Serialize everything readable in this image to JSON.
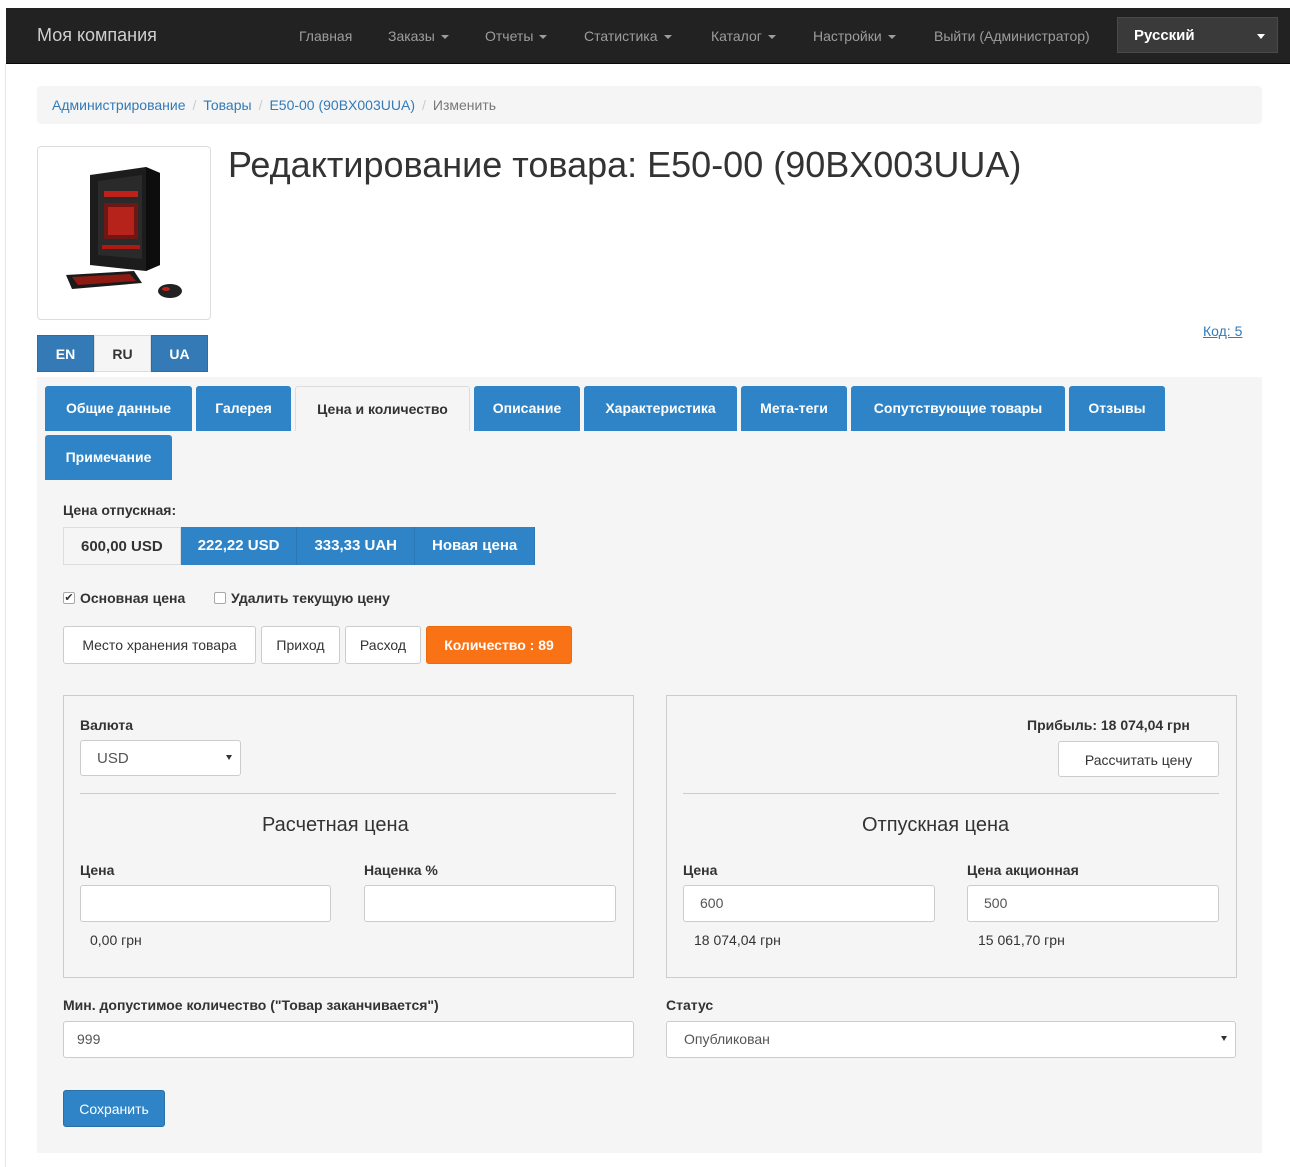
{
  "navbar": {
    "brand": "Моя компания",
    "items": [
      {
        "label": "Главная",
        "dropdown": false
      },
      {
        "label": "Заказы",
        "dropdown": true
      },
      {
        "label": "Отчеты",
        "dropdown": true
      },
      {
        "label": "Статистика",
        "dropdown": true
      },
      {
        "label": "Каталог",
        "dropdown": true
      },
      {
        "label": "Настройки",
        "dropdown": true
      },
      {
        "label": "Выйти (Администратор)",
        "dropdown": false
      }
    ],
    "language": "Русский"
  },
  "breadcrumb": [
    "Администрирование",
    "Товары",
    "E50-00 (90BX003UUA)",
    "Изменить"
  ],
  "page_title": "Редактирование товара: E50-00 (90BX003UUA)",
  "code_link": "Код: 5",
  "lang_tabs": [
    {
      "label": "EN",
      "active": false
    },
    {
      "label": "RU",
      "active": true
    },
    {
      "label": "UA",
      "active": false
    }
  ],
  "tabs": [
    {
      "label": "Общие данные",
      "active": false
    },
    {
      "label": "Галерея",
      "active": false
    },
    {
      "label": "Цена и количество",
      "active": true
    },
    {
      "label": "Описание",
      "active": false
    },
    {
      "label": "Характеристика",
      "active": false
    },
    {
      "label": "Мета-теги",
      "active": false
    },
    {
      "label": "Сопутствующие товары",
      "active": false
    },
    {
      "label": "Отзывы",
      "active": false
    },
    {
      "label": "Примечание",
      "active": false
    }
  ],
  "price": {
    "label": "Цена отпускная:",
    "buttons": [
      {
        "label": "600,00 USD",
        "active": true
      },
      {
        "label": "222,22 USD",
        "active": false
      },
      {
        "label": "333,33 UAH",
        "active": false
      },
      {
        "label": "Новая цена",
        "active": false
      }
    ],
    "main_price_label": "Основная цена",
    "main_price_checked": true,
    "delete_price_label": "Удалить текущую цену",
    "delete_price_checked": false
  },
  "stock_buttons": {
    "storage": "Место хранения товара",
    "income": "Приход",
    "expense": "Расход",
    "quantity": "Количество : 89"
  },
  "calc_panel": {
    "currency_label": "Валюта",
    "currency_value": "USD",
    "title": "Расчетная цена",
    "price_label": "Цена",
    "price_value": "",
    "markup_label": "Наценка %",
    "markup_value": "",
    "price_converted": "0,00 грн"
  },
  "sale_panel": {
    "profit": "Прибыль: 18 074,04 грн",
    "calc_button": "Рассчитать цену",
    "title": "Отпускная цена",
    "price_label": "Цена",
    "price_value": "600",
    "price_converted": "18 074,04 грн",
    "promo_label": "Цена акционная",
    "promo_value": "500",
    "promo_converted": "15 061,70 грн"
  },
  "min_qty": {
    "label": "Мин. допустимое количество (\"Товар заканчивается\")",
    "value": "999"
  },
  "status": {
    "label": "Статус",
    "value": "Опубликован"
  },
  "save_button": "Сохранить",
  "colors": {
    "primary": "#2e84c6",
    "quantity_badge": "#f97316",
    "navbar": "#222222"
  }
}
